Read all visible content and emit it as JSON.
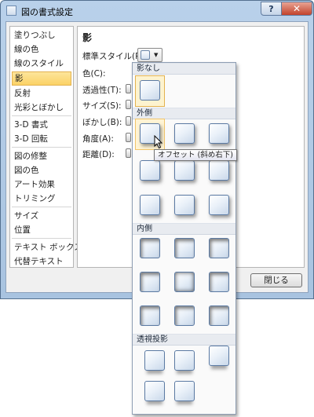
{
  "window": {
    "title": "図の書式設定",
    "help_label": "?",
    "close_label": "✕"
  },
  "sidebar": {
    "items": [
      {
        "label": "塗りつぶし"
      },
      {
        "label": "線の色"
      },
      {
        "label": "線のスタイル"
      },
      {
        "label": "影",
        "selected": true
      },
      {
        "label": "反射"
      },
      {
        "label": "光彩とぼかし"
      },
      {
        "label": "3-D 書式"
      },
      {
        "label": "3-D 回転"
      },
      {
        "label": "図の修整"
      },
      {
        "label": "図の色"
      },
      {
        "label": "アート効果"
      },
      {
        "label": "トリミング"
      },
      {
        "label": "サイズ"
      },
      {
        "label": "位置"
      },
      {
        "label": "テキスト ボックス"
      },
      {
        "label": "代替テキスト"
      }
    ]
  },
  "panel": {
    "title": "影",
    "preset_label": "標準スタイル(P):",
    "color_label": "色(C):",
    "transparency_label": "透過性(T):",
    "size_label": "サイズ(S):",
    "blur_label": "ぼかし(B):",
    "angle_label": "角度(A):",
    "distance_label": "距離(D):"
  },
  "footer": {
    "close_button": "閉じる"
  },
  "gallery": {
    "sections": {
      "none": "影なし",
      "outer": "外側",
      "inner": "内側",
      "perspective": "透視投影"
    },
    "tooltip": "オフセット (斜め右下)"
  },
  "colors": {
    "selection": "#fbd266",
    "thumb_border": "#5b7aa3",
    "close": "#c2432c"
  },
  "icons": {
    "help": "help-icon",
    "close": "close-icon",
    "dropdown": "chevron-down-icon",
    "cursor": "mouse-pointer-icon"
  }
}
